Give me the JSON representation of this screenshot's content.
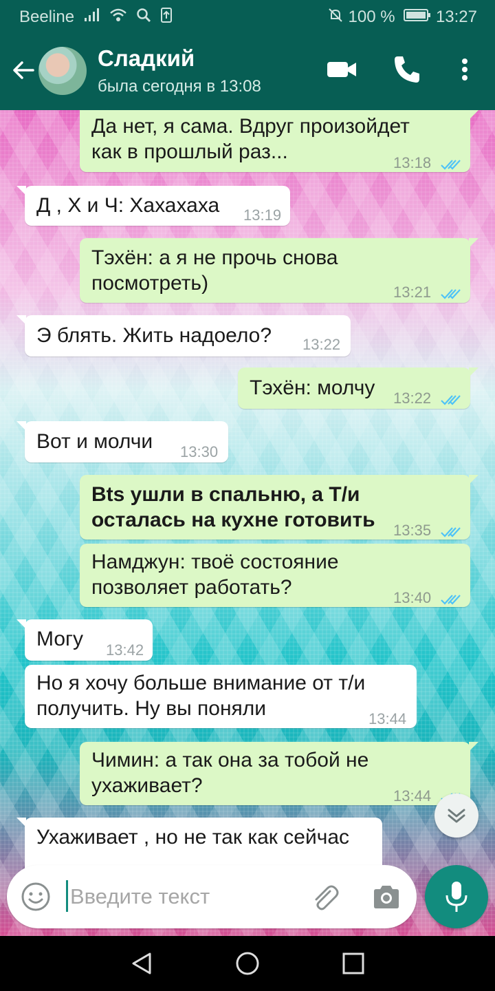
{
  "status_bar": {
    "carrier": "Beeline",
    "battery": "100 %",
    "time": "13:27",
    "icons": [
      "signal-icon",
      "wifi-icon",
      "search-icon",
      "upload-icon",
      "bell-off-icon",
      "battery-icon"
    ]
  },
  "header": {
    "contact_name": "Сладкий",
    "last_seen": "была сегодня в 13:08",
    "actions": [
      "back-arrow-icon",
      "video-call-icon",
      "phone-icon",
      "more-icon"
    ]
  },
  "messages": [
    {
      "direction": "out",
      "text": "Да нет, я сама. Вдруг произойдет\nкак в прошлый раз...",
      "time": "13:18",
      "read": true
    },
    {
      "direction": "in",
      "text": "Д , Х и Ч: Хахахаха",
      "time": "13:19"
    },
    {
      "direction": "out",
      "text": "Тэхён: а я не прочь снова\nпосмотреть)",
      "time": "13:21",
      "read": true
    },
    {
      "direction": "in",
      "text": "Э блять. Жить надоело?",
      "time": "13:22"
    },
    {
      "direction": "out",
      "text": "Тэхён: молчу",
      "time": "13:22",
      "read": true
    },
    {
      "direction": "in",
      "text": "Вот и молчи",
      "time": "13:30"
    },
    {
      "direction": "out",
      "text": "Bts ушли в спальню, а Т/и\nосталась на кухне готовить",
      "time": "13:35",
      "read": true,
      "bold": true
    },
    {
      "direction": "out",
      "text": "Намджун: твоё состояние\nпозволяет  работать?",
      "time": "13:40",
      "read": true
    },
    {
      "direction": "in",
      "text": "Могу",
      "time": "13:42"
    },
    {
      "direction": "in",
      "text": "Но я хочу больше внимание от т/и\nполучить. Ну вы поняли",
      "time": "13:44"
    },
    {
      "direction": "out",
      "text": "Чимин: а так она за тобой не\nухаживает?",
      "time": "13:44",
      "read": true
    },
    {
      "direction": "in",
      "text": "Ухаживает , но не так как сейчас",
      "time": ""
    }
  ],
  "composer": {
    "placeholder": "Введите текст",
    "value": ""
  },
  "colors": {
    "header": "#075e54",
    "outgoing_bubble": "#dcf8c6",
    "incoming_bubble": "#ffffff",
    "accent": "#128c7e",
    "read_ticks": "#4fc3f7"
  }
}
